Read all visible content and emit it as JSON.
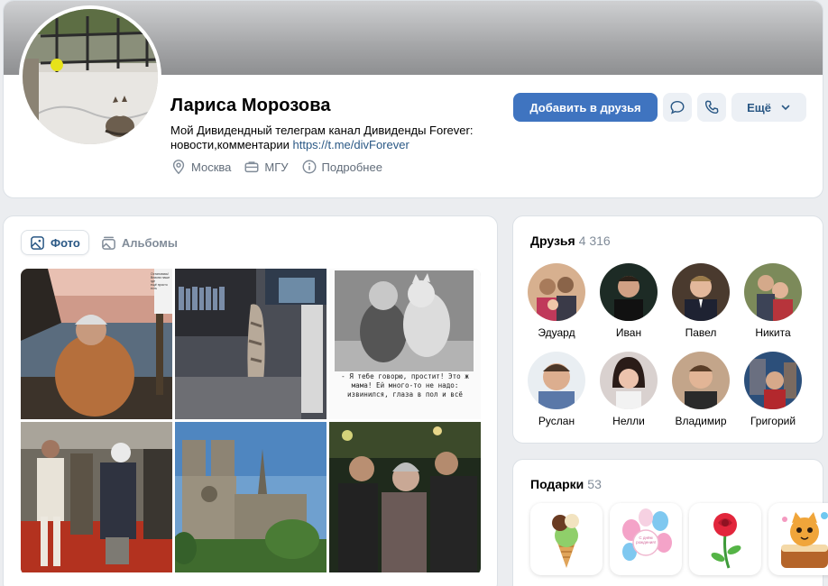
{
  "profile": {
    "name": "Лариса Морозова",
    "status_text": "Мой Дивидендный телеграм канал Дивиденды Forever: новости,комментарии ",
    "status_link": "https://t.me/divForever",
    "city": "Москва",
    "university": "МГУ",
    "more_info": "Подробнее",
    "add_friend_label": "Добавить в друзья",
    "more_label": "Ещё",
    "icons": {
      "message": "message-icon",
      "call": "phone-icon",
      "city": "location-pin-icon",
      "university": "education-icon",
      "info": "info-icon"
    }
  },
  "photos": {
    "tabs": [
      {
        "label": "Фото",
        "icon": "photo-icon",
        "active": true
      },
      {
        "label": "Альбомы",
        "icon": "albums-icon",
        "active": false
      }
    ],
    "items": [
      {
        "desc": "woman-by-the-sea",
        "overlay_text": "Остановись! Вникни наше где ещё просто есть"
      },
      {
        "desc": "cat-on-shelf"
      },
      {
        "desc": "child-with-cat",
        "caption": "- Я тебе говорю, простит! Это ж мама! Ей много-то не надо: извинился, глаза в пол и всё"
      },
      {
        "desc": "people-in-crowd"
      },
      {
        "desc": "notre-dame-cathedral"
      },
      {
        "desc": "three-people-event"
      }
    ]
  },
  "friends": {
    "title": "Друзья",
    "count": "4 316",
    "items": [
      {
        "name": "Эдуард"
      },
      {
        "name": "Иван"
      },
      {
        "name": "Павел"
      },
      {
        "name": "Никита"
      },
      {
        "name": "Руслан"
      },
      {
        "name": "Нелли"
      },
      {
        "name": "Владимир"
      },
      {
        "name": "Григорий"
      }
    ]
  },
  "gifts": {
    "title": "Подарки",
    "count": "53",
    "items": [
      {
        "desc": "ice-cream-gift"
      },
      {
        "desc": "balloons-gift",
        "text": "С днём рождения!"
      },
      {
        "desc": "rose-gift"
      },
      {
        "desc": "cat-cake-gift"
      }
    ]
  },
  "colors": {
    "accent": "#3f74c0",
    "link": "#2a5885",
    "secondary_text": "#626d7a",
    "background": "#ebedf0"
  }
}
